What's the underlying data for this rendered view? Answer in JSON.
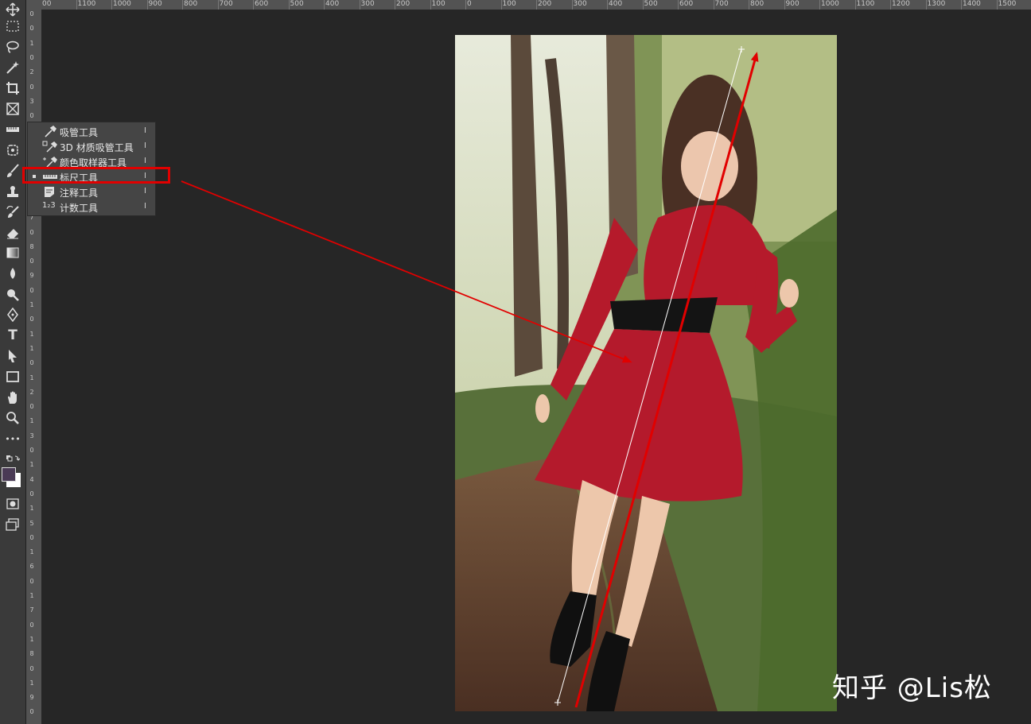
{
  "rulers": {
    "horizontal": [
      "00",
      "1100",
      "1000",
      "900",
      "800",
      "700",
      "600",
      "500",
      "400",
      "300",
      "200",
      "100",
      "0",
      "100",
      "200",
      "300",
      "400",
      "500",
      "600",
      "700",
      "800",
      "900",
      "1000",
      "1100",
      "1200",
      "1300",
      "1400",
      "1500"
    ],
    "vertical": [
      "0",
      "0",
      "1",
      "0",
      "2",
      "0",
      "3",
      "0",
      "4",
      "0",
      "5",
      "0",
      "6",
      "0",
      "7",
      "0",
      "8",
      "0",
      "9",
      "0",
      "1",
      "0",
      "1",
      "1",
      "0",
      "1",
      "2",
      "0",
      "1",
      "3",
      "0",
      "1",
      "4",
      "0",
      "1",
      "5",
      "0",
      "1",
      "6",
      "0",
      "1",
      "7",
      "0",
      "1",
      "8",
      "0",
      "1",
      "9",
      "0"
    ]
  },
  "flyout": {
    "items": [
      {
        "label": "吸管工具",
        "key": "I",
        "icon": "eyedropper-icon",
        "active": false
      },
      {
        "label": "3D 材质吸管工具",
        "key": "I",
        "icon": "3d-material-eyedropper-icon",
        "active": false
      },
      {
        "label": "颜色取样器工具",
        "key": "I",
        "icon": "color-sampler-icon",
        "active": false
      },
      {
        "label": "标尺工具",
        "key": "I",
        "icon": "ruler-icon",
        "active": true
      },
      {
        "label": "注释工具",
        "key": "I",
        "icon": "note-icon",
        "active": false
      },
      {
        "label": "计数工具",
        "key": "I",
        "icon": "count-icon",
        "active": false
      }
    ],
    "count_glyph": "1₂3"
  },
  "tools": [
    "move-icon",
    "marquee-icon",
    "lasso-icon",
    "magic-wand-icon",
    "crop-icon",
    "frame-icon",
    "eyedropper-ruler-icon",
    "healing-icon",
    "brush-icon",
    "stamp-icon",
    "history-brush-icon",
    "eraser-icon",
    "gradient-icon",
    "blur-icon",
    "dodge-icon",
    "pen-icon",
    "type-icon",
    "path-select-icon",
    "rectangle-icon",
    "hand-icon",
    "zoom-icon",
    "more-icon"
  ],
  "type_glyph": "T",
  "more_glyph": "•••",
  "colors": {
    "accent": "#e10000",
    "foreground_swatch": "#4a3a55",
    "background_swatch": "#ffffff"
  },
  "watermark": "知乎 @Lis松"
}
